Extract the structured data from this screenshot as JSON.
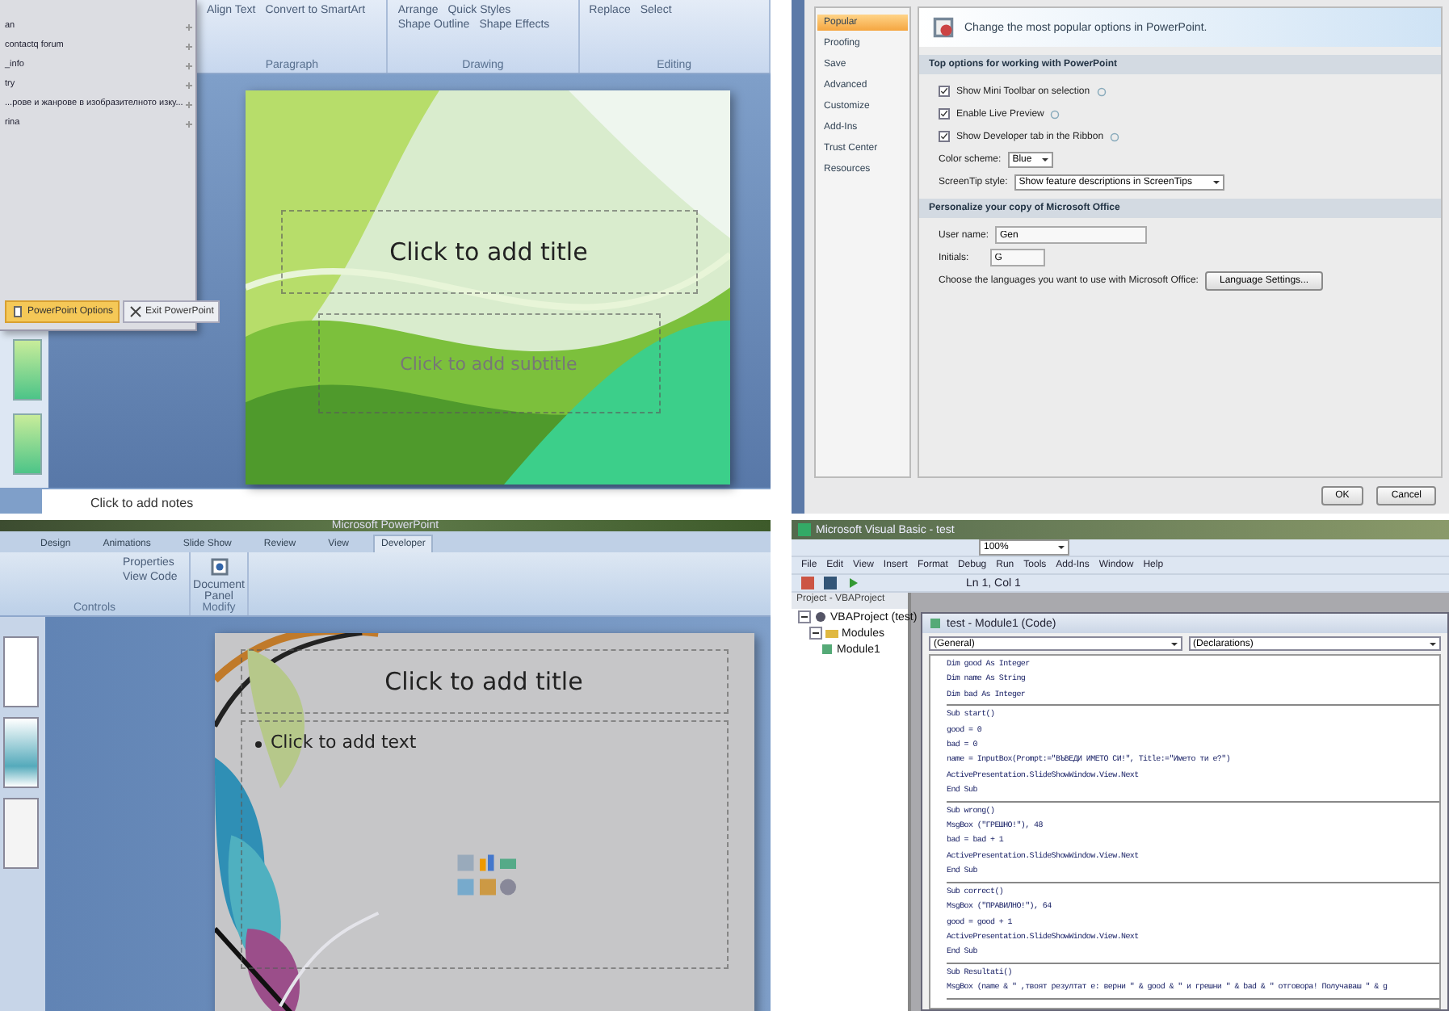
{
  "pp_edit": {
    "office_menu": {
      "recent": [
        "an",
        "contactq forum",
        "_info",
        "try",
        "...рове и жанрове в изобразителното изку...",
        "rina"
      ],
      "buttons": [
        "PowerPoint Options",
        "Exit PowerPoint"
      ]
    },
    "ribbon": [
      {
        "label": "Paragraph",
        "items": [
          "Align Text",
          "Convert to SmartArt"
        ]
      },
      {
        "label": "Drawing",
        "items": [
          "Arrange",
          "Quick Styles",
          "Shape Outline",
          "Shape Effects"
        ]
      },
      {
        "label": "Editing",
        "items": [
          "Replace",
          "Select"
        ]
      }
    ],
    "slide": {
      "title": "Click to add title",
      "subtitle": "Click to add subtitle"
    },
    "notes": "Click to add notes"
  },
  "options": {
    "nav": [
      {
        "label": "Popular",
        "selected": true
      },
      {
        "label": "Proofing",
        "selected": false
      },
      {
        "label": "Save",
        "selected": false
      },
      {
        "label": "Advanced",
        "selected": false
      },
      {
        "label": "Customize",
        "selected": false
      },
      {
        "label": "Add-Ins",
        "selected": false
      },
      {
        "label": "Trust Center",
        "selected": false
      },
      {
        "label": "Resources",
        "selected": false
      }
    ],
    "header": "Change the most popular options in PowerPoint.",
    "top": {
      "title": "Top options for working with PowerPoint",
      "checkboxes": [
        {
          "label": "Show Mini Toolbar on selection",
          "checked": true
        },
        {
          "label": "Enable Live Preview",
          "checked": true
        },
        {
          "label": "Show Developer tab in the Ribbon",
          "checked": true
        }
      ],
      "color_scheme": {
        "label": "Color scheme:",
        "value": "Blue"
      },
      "screentip": {
        "label": "ScreenTip style:",
        "value": "Show feature descriptions in ScreenTips"
      }
    },
    "personalize": {
      "title": "Personalize your copy of Microsoft Office",
      "user_name": {
        "label": "User name:",
        "value": "Gen"
      },
      "initials": {
        "label": "Initials:",
        "value": "G"
      },
      "languages_text": "Choose the languages you want to use with Microsoft Office:",
      "languages_button": "Language Settings..."
    },
    "buttons": [
      "OK",
      "Cancel"
    ]
  },
  "pp_dev": {
    "title": "Microsoft PowerPoint",
    "tabs": [
      {
        "label": "Design",
        "selected": false
      },
      {
        "label": "Animations",
        "selected": false
      },
      {
        "label": "Slide Show",
        "selected": false
      },
      {
        "label": "Review",
        "selected": false
      },
      {
        "label": "View",
        "selected": false
      },
      {
        "label": "Developer",
        "selected": true
      }
    ],
    "controls": {
      "items": [
        "Properties",
        "View Code"
      ],
      "label": "Controls"
    },
    "modify": {
      "button": "Document Panel",
      "label": "Modify"
    },
    "slide": {
      "title": "Click to add title",
      "text": "Click to add text"
    }
  },
  "vba": {
    "title": "Microsoft Visual Basic - test",
    "zoom": "100%",
    "menu": [
      "File",
      "Edit",
      "View",
      "Insert",
      "Format",
      "Debug",
      "Run",
      "Tools",
      "Add-Ins",
      "Window",
      "Help"
    ],
    "position": "Ln 1, Col 1",
    "project": {
      "title": "Project - VBAProject",
      "tree": [
        {
          "label": "VBAProject (test)",
          "expanded": true,
          "children": [
            {
              "label": "Modules",
              "expanded": true,
              "children": [
                {
                  "label": "Module1"
                }
              ]
            }
          ]
        }
      ]
    },
    "code_window": {
      "title": "test - Module1 (Code)",
      "object": "(General)",
      "procedure": "(Declarations)",
      "blocks": [
        [
          "Dim good As Integer",
          "Dim name As String",
          "Dim bad As Integer"
        ],
        [
          "Sub start()",
          "good = 0",
          "bad = 0",
          "name = InputBox(Prompt:=\"ВЪВЕДИ ИМЕТО СИ!\", Title:=\"Името ти е?\")",
          "ActivePresentation.SlideShowWindow.View.Next",
          "End Sub"
        ],
        [
          "Sub wrong()",
          "MsgBox (\"ГРЕШНО!\"), 48",
          "bad = bad + 1",
          "ActivePresentation.SlideShowWindow.View.Next",
          "End Sub"
        ],
        [
          "Sub correct()",
          "MsgBox (\"ПРАВИЛНО!\"), 64",
          "good = good + 1",
          "ActivePresentation.SlideShowWindow.View.Next",
          "End Sub"
        ],
        [
          "Sub Resultati()",
          "MsgBox (name & \" ,твоят резултат е: верни \" & good & \" и грешни \" & bad & \" отговора! Получаваш \" & g"
        ]
      ]
    }
  }
}
